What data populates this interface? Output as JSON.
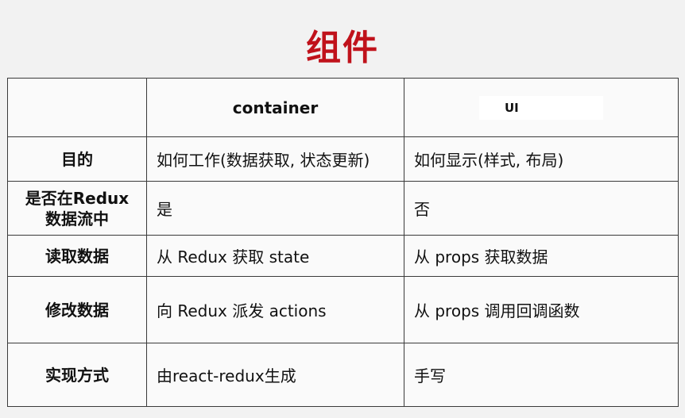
{
  "title": "组件",
  "table": {
    "header": {
      "corner": "",
      "col2": "container",
      "col3": "UI"
    },
    "rows": [
      {
        "label": "目的",
        "container": "如何工作(数据获取, 状态更新)",
        "ui": "如何显示(样式, 布局)"
      },
      {
        "label_line1": "是否在Redux",
        "label_line2": "数据流中",
        "container": "是",
        "ui": "否"
      },
      {
        "label": "读取数据",
        "container": "从 Redux 获取 state",
        "ui": "从 props 获取数据"
      },
      {
        "label": "修改数据",
        "container": "向 Redux 派发 actions",
        "ui": "从 props 调用回调函数"
      },
      {
        "label": "实现方式",
        "container": "由react-redux生成",
        "ui": "手写"
      }
    ]
  },
  "colors": {
    "title": "#c0121b",
    "border": "#3a3a3a",
    "background": "#f2f2f2"
  }
}
